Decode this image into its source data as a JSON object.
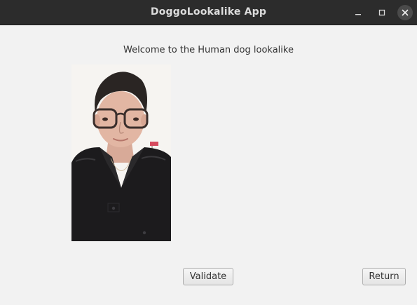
{
  "window": {
    "title": "DoggoLookalike App",
    "controls": {
      "minimize_icon": "minimize-icon",
      "maximize_icon": "maximize-icon",
      "close_icon": "close-icon"
    }
  },
  "main": {
    "welcome_text": "Welcome to the Human dog lookalike",
    "photo": {
      "subject": "person-photo"
    },
    "buttons": {
      "validate_label": "Validate",
      "return_label": "Return"
    }
  },
  "colors": {
    "titlebar_bg": "#2c2c2c",
    "content_bg": "#f2f2f2",
    "title_text": "#dcdcdc"
  }
}
